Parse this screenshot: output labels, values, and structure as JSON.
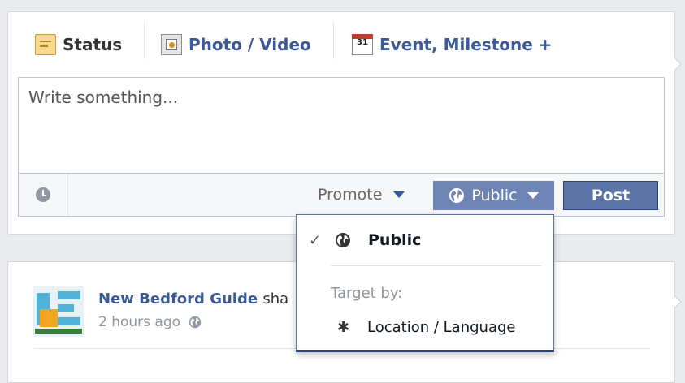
{
  "composer": {
    "tabs": [
      {
        "label": "Status",
        "icon": "status-icon"
      },
      {
        "label": "Photo / Video",
        "icon": "photo-icon"
      },
      {
        "label": "Event, Milestone +",
        "icon": "calendar-icon",
        "icon_text": "31"
      }
    ],
    "placeholder": "Write something...",
    "promote_label": "Promote",
    "audience_label": "Public",
    "post_label": "Post"
  },
  "feed": {
    "page_name": "New Bedford Guide",
    "action_text": "sha",
    "time": "2 hours ago"
  },
  "dropdown": {
    "selected_label": "Public",
    "check": "✓",
    "target_label": "Target by:",
    "location_label": "Location / Language"
  },
  "colors": {
    "link": "#3b5998",
    "button": "#6d84b4",
    "post_button": "#5b74a8",
    "background": "#e9ebee"
  }
}
